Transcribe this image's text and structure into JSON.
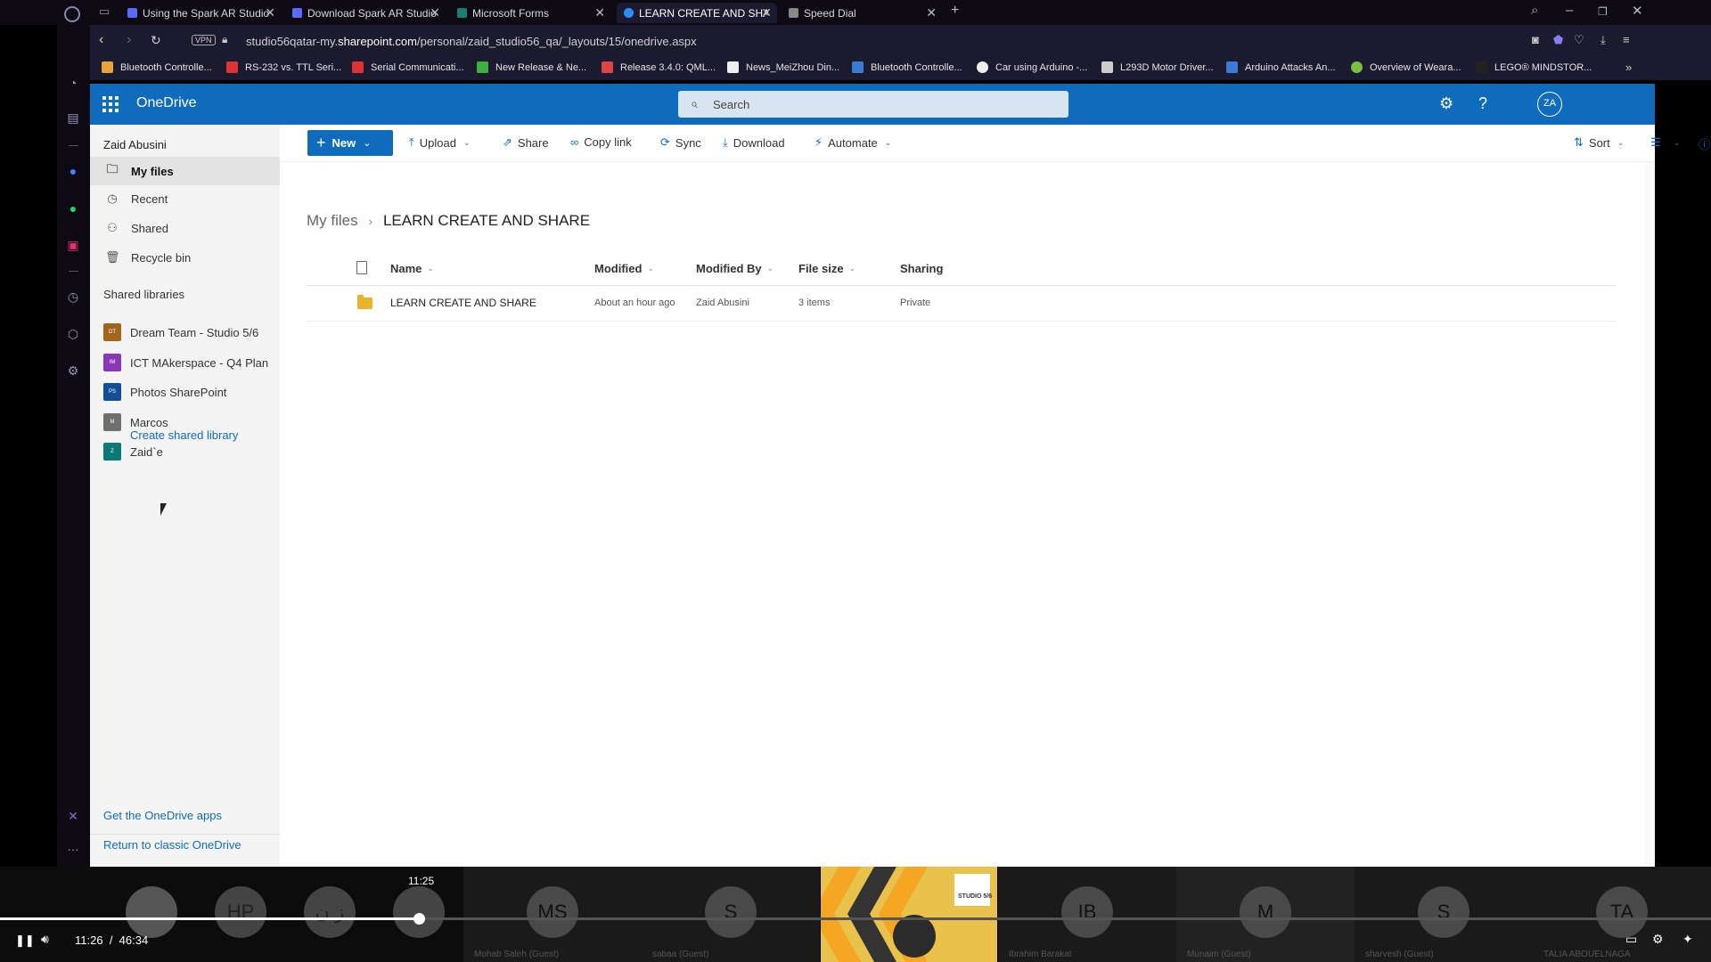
{
  "browser": {
    "tabs": [
      {
        "label": "Using the Spark AR Studio",
        "color": "#5c6bff"
      },
      {
        "label": "Download Spark AR Studio",
        "color": "#5c6bff"
      },
      {
        "label": "Microsoft Forms",
        "color": "#1a7f6e"
      },
      {
        "label": "LEARN CREATE AND SHARE",
        "color": "#2b8cff"
      },
      {
        "label": "Speed Dial",
        "color": "#888888"
      }
    ],
    "url_prefix": "studio56qatar-my.",
    "url_domain": "sharepoint.com",
    "url_path": "/personal/zaid_studio56_qa/_layouts/15/onedrive.aspx",
    "vpn_label": "VPN",
    "bookmarks": [
      {
        "label": "Bluetooth Controlle...",
        "color": "#e8a33a"
      },
      {
        "label": "RS-232 vs. TTL Seri...",
        "color": "#d33"
      },
      {
        "label": "Serial Communicati...",
        "color": "#d33"
      },
      {
        "label": "New Release & Ne...",
        "color": "#3cb043"
      },
      {
        "label": "Release 3.4.0: QML...",
        "color": "#d44"
      },
      {
        "label": "News_MeiZhou Din...",
        "color": "#eee"
      },
      {
        "label": "Bluetooth Controlle...",
        "color": "#3a7bd5"
      },
      {
        "label": "Car using Arduino -...",
        "color": "#eee"
      },
      {
        "label": "L293D Motor Driver...",
        "color": "#ccc"
      },
      {
        "label": "Arduino Attacks An...",
        "color": "#3a7bd5"
      },
      {
        "label": "Overview of Weara...",
        "color": "#7bc043"
      },
      {
        "label": "LEGO® MINDSTOR...",
        "color": "#222"
      }
    ]
  },
  "onedrive": {
    "brand": "OneDrive",
    "search_placeholder": "Search",
    "avatar_initials": "ZA",
    "user_name": "Zaid Abusini",
    "nav": [
      {
        "label": "My files",
        "icon": "folder-icon"
      },
      {
        "label": "Recent",
        "icon": "clock-icon"
      },
      {
        "label": "Shared",
        "icon": "people-icon"
      },
      {
        "label": "Recycle bin",
        "icon": "recycle-bin-icon"
      }
    ],
    "shared_libraries_title": "Shared libraries",
    "libraries": [
      {
        "label": "Dream Team - Studio 5/6",
        "abbr": "DT",
        "color": "#a0671c"
      },
      {
        "label": "ICT MAkerspace - Q4 Plan",
        "abbr": "IM",
        "color": "#8a36b8"
      },
      {
        "label": "Photos SharePoint",
        "abbr": "PS",
        "color": "#124e96"
      },
      {
        "label": "Marcos",
        "abbr": "M",
        "color": "#6f6f6f"
      },
      {
        "label": "Zaid`e",
        "abbr": "Z",
        "color": "#0b7a75"
      }
    ],
    "create_library": "Create shared library",
    "get_apps": "Get the OneDrive apps",
    "return_classic": "Return to classic OneDrive",
    "commands": {
      "new": "New",
      "upload": "Upload",
      "share": "Share",
      "copy_link": "Copy link",
      "sync": "Sync",
      "download": "Download",
      "automate": "Automate",
      "sort": "Sort"
    },
    "breadcrumb": {
      "root": "My files",
      "current": "LEARN CREATE AND SHARE"
    },
    "columns": {
      "name": "Name",
      "modified": "Modified",
      "modified_by": "Modified By",
      "file_size": "File size",
      "sharing": "Sharing"
    },
    "rows": [
      {
        "name": "LEARN CREATE AND SHARE",
        "modified": "About an hour ago",
        "modified_by": "Zaid Abusini",
        "file_size": "3 items",
        "sharing": "Private"
      }
    ]
  },
  "conference": {
    "participants": [
      {
        "initials": "",
        "name": ""
      },
      {
        "initials": "HP",
        "name": ""
      },
      {
        "initials": "ز ن",
        "name": ""
      },
      {
        "initials": "",
        "name": ""
      },
      {
        "initials": "MS",
        "name": "Mohab Saleh (Guest)"
      },
      {
        "initials": "S",
        "name": "sabaa (Guest)"
      },
      {
        "initials": "IB",
        "name": "Ibrahim Barakat"
      },
      {
        "initials": "M",
        "name": "Munaim (Guest)"
      },
      {
        "initials": "S",
        "name": "sharvesh (Guest)"
      },
      {
        "initials": "TA",
        "name": "TALIA ABOUELNAGA"
      }
    ],
    "video_logo": "STUDIO 5/6"
  },
  "player": {
    "tooltip_time": "11:25",
    "current_time": "11:26",
    "separator": "/",
    "total_time": "46:34",
    "progress": 0.245
  }
}
